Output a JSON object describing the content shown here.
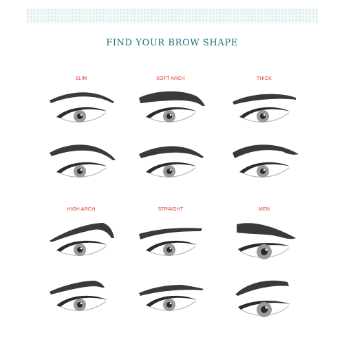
{
  "header": {
    "title": "FIND YOUR BROW SHAPE"
  },
  "colors": {
    "title": "#1f6f7c",
    "label": "#e2312b",
    "brow": "#3a3a3a",
    "iris": "#9a9a9a",
    "pupil": "#2b2b2b"
  },
  "shapes": [
    {
      "label": "SLIM",
      "figures": [
        {
          "brow": "slim"
        },
        {
          "brow": "slim-alt"
        }
      ]
    },
    {
      "label": "SOFT ARCH",
      "figures": [
        {
          "brow": "soft-arch"
        },
        {
          "brow": "soft-arch-alt"
        }
      ]
    },
    {
      "label": "THICK",
      "figures": [
        {
          "brow": "thick"
        },
        {
          "brow": "thick-alt"
        }
      ]
    },
    {
      "label": "HIGH ARCH",
      "figures": [
        {
          "brow": "high-arch"
        },
        {
          "brow": "high-arch-alt"
        }
      ]
    },
    {
      "label": "STRAIGHT",
      "figures": [
        {
          "brow": "straight"
        },
        {
          "brow": "straight-alt"
        }
      ]
    },
    {
      "label": "MEN",
      "figures": [
        {
          "brow": "men"
        },
        {
          "brow": "men-alt"
        }
      ]
    }
  ]
}
